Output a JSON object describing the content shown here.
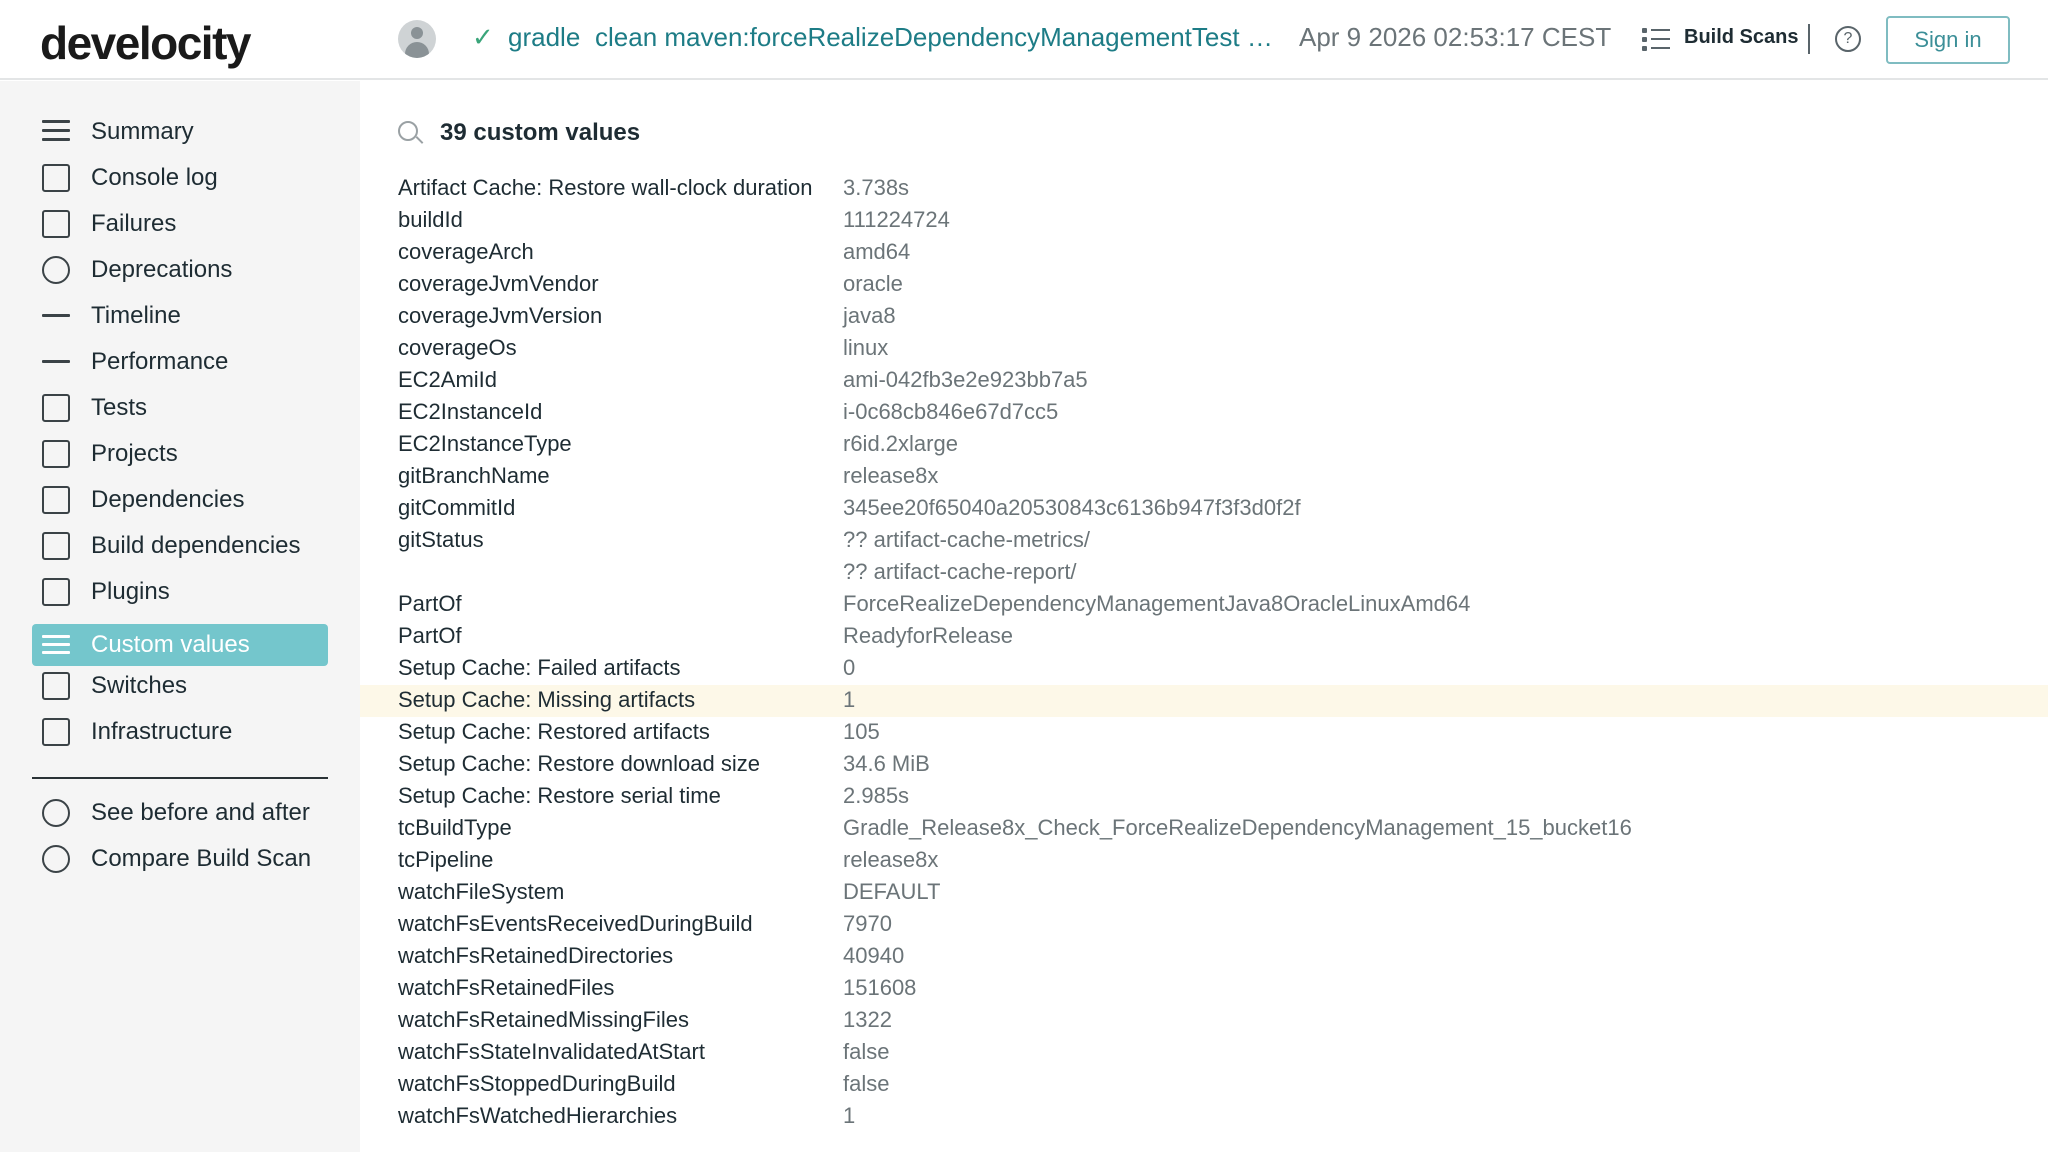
{
  "header": {
    "logo": "develocity",
    "build_tool": "gradle",
    "build_command": "clean maven:forceRealizeDependencyManagementTest plu...",
    "build_date": "Apr 9 2026 02:53:17 CEST",
    "build_scans_label": "Build Scans",
    "help_label": "?",
    "sign_in_label": "Sign in",
    "status": "success",
    "status_glyph": "✓"
  },
  "sidebar": {
    "items": [
      {
        "label": "Summary",
        "icon": "summary-icon"
      },
      {
        "label": "Console log",
        "icon": "console-log-icon"
      },
      {
        "label": "Failures",
        "icon": "failures-icon"
      },
      {
        "label": "Deprecations",
        "icon": "deprecations-icon"
      },
      {
        "label": "Timeline",
        "icon": "timeline-icon"
      },
      {
        "label": "Performance",
        "icon": "performance-icon"
      },
      {
        "label": "Tests",
        "icon": "tests-icon"
      },
      {
        "label": "Projects",
        "icon": "projects-icon"
      },
      {
        "label": "Dependencies",
        "icon": "dependencies-icon"
      },
      {
        "label": "Build dependencies",
        "icon": "build-dependencies-icon"
      },
      {
        "label": "Plugins",
        "icon": "plugins-icon"
      },
      {
        "label": "Custom values",
        "icon": "custom-values-icon",
        "active": true
      },
      {
        "label": "Switches",
        "icon": "switches-icon"
      },
      {
        "label": "Infrastructure",
        "icon": "infrastructure-icon"
      }
    ],
    "extra_items": [
      {
        "label": "See before and after",
        "icon": "history-icon"
      },
      {
        "label": "Compare Build Scan",
        "icon": "compare-icon"
      }
    ],
    "active_color": "#74c6cc"
  },
  "main": {
    "search_label": "39 custom values",
    "highlight_color": "#fdf8e8",
    "rows": [
      {
        "key": "Artifact Cache: Restore wall-clock duration",
        "value": "3.738s"
      },
      {
        "key": "buildId",
        "value": "111224724"
      },
      {
        "key": "coverageArch",
        "value": "amd64"
      },
      {
        "key": "coverageJvmVendor",
        "value": "oracle"
      },
      {
        "key": "coverageJvmVersion",
        "value": "java8"
      },
      {
        "key": "coverageOs",
        "value": "linux"
      },
      {
        "key": "EC2AmiId",
        "value": "ami-042fb3e2e923bb7a5"
      },
      {
        "key": "EC2InstanceId",
        "value": "i-0c68cb846e67d7cc5"
      },
      {
        "key": "EC2InstanceType",
        "value": "r6id.2xlarge"
      },
      {
        "key": "gitBranchName",
        "value": "release8x"
      },
      {
        "key": "gitCommitId",
        "value": "345ee20f65040a20530843c6136b947f3f3d0f2f"
      },
      {
        "key": "gitStatus",
        "value": "?? artifact-cache-metrics/"
      },
      {
        "key": "",
        "value": "?? artifact-cache-report/"
      },
      {
        "key": "PartOf",
        "value": "ForceRealizeDependencyManagementJava8OracleLinuxAmd64"
      },
      {
        "key": "PartOf",
        "value": "ReadyforRelease"
      },
      {
        "key": "Setup Cache: Failed artifacts",
        "value": "0"
      },
      {
        "key": "Setup Cache: Missing artifacts",
        "value": "1",
        "highlight": true
      },
      {
        "key": "Setup Cache: Restored artifacts",
        "value": "105"
      },
      {
        "key": "Setup Cache: Restore download size",
        "value": "34.6 MiB"
      },
      {
        "key": "Setup Cache: Restore serial time",
        "value": "2.985s"
      },
      {
        "key": "tcBuildType",
        "value": "Gradle_Release8x_Check_ForceRealizeDependencyManagement_15_bucket16"
      },
      {
        "key": "tcPipeline",
        "value": "release8x"
      },
      {
        "key": "watchFileSystem",
        "value": "DEFAULT"
      },
      {
        "key": "watchFsEventsReceivedDuringBuild",
        "value": "7970"
      },
      {
        "key": "watchFsRetainedDirectories",
        "value": "40940"
      },
      {
        "key": "watchFsRetainedFiles",
        "value": "151608"
      },
      {
        "key": "watchFsRetainedMissingFiles",
        "value": "1322"
      },
      {
        "key": "watchFsStateInvalidatedAtStart",
        "value": "false"
      },
      {
        "key": "watchFsStoppedDuringBuild",
        "value": "false"
      },
      {
        "key": "watchFsWatchedHierarchies",
        "value": "1"
      }
    ]
  }
}
